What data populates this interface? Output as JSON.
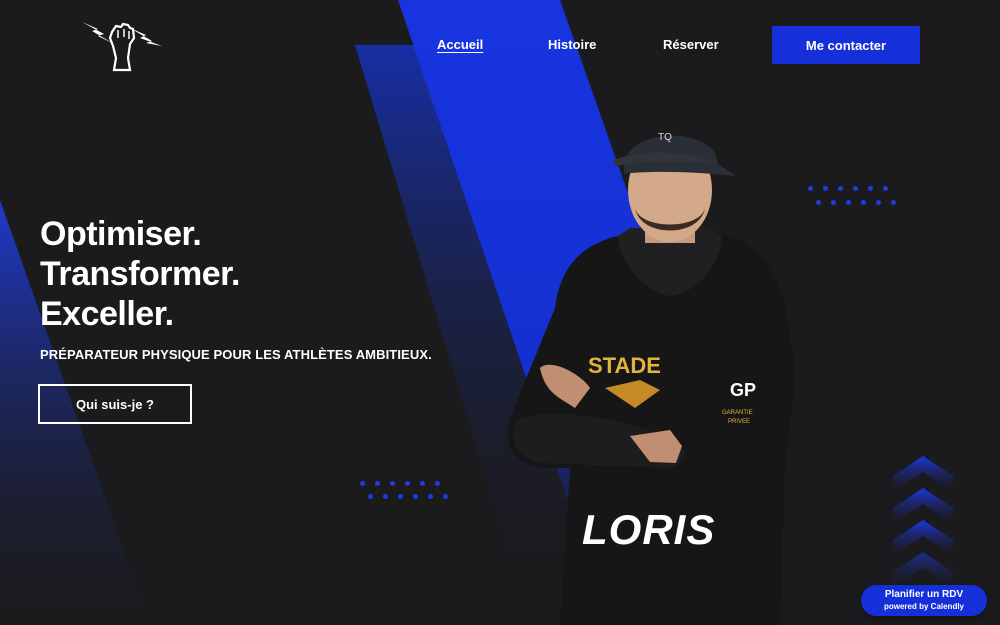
{
  "header": {
    "logo_icon": "raised-fist-lightning-icon",
    "nav": [
      {
        "label": "Accueil",
        "active": true
      },
      {
        "label": "Histoire",
        "active": false
      },
      {
        "label": "Réserver",
        "active": false
      }
    ],
    "cta_label": "Me contacter"
  },
  "hero": {
    "lines": [
      "Optimiser.",
      "Transformer.",
      "Exceller."
    ],
    "subtitle": "PRÉPARATEUR PHYSIQUE POUR LES ATHLÈTES AMBITIEUX.",
    "button_label": "Qui suis-je ?",
    "person_name": "LORIS",
    "photo_icon": "athlete-portrait-photo"
  },
  "calendly": {
    "main": "Planifier un RDV",
    "sub": "powered by Calendly"
  },
  "colors": {
    "background": "#1b1b1d",
    "accent": "#1530d9",
    "text": "#ffffff"
  }
}
